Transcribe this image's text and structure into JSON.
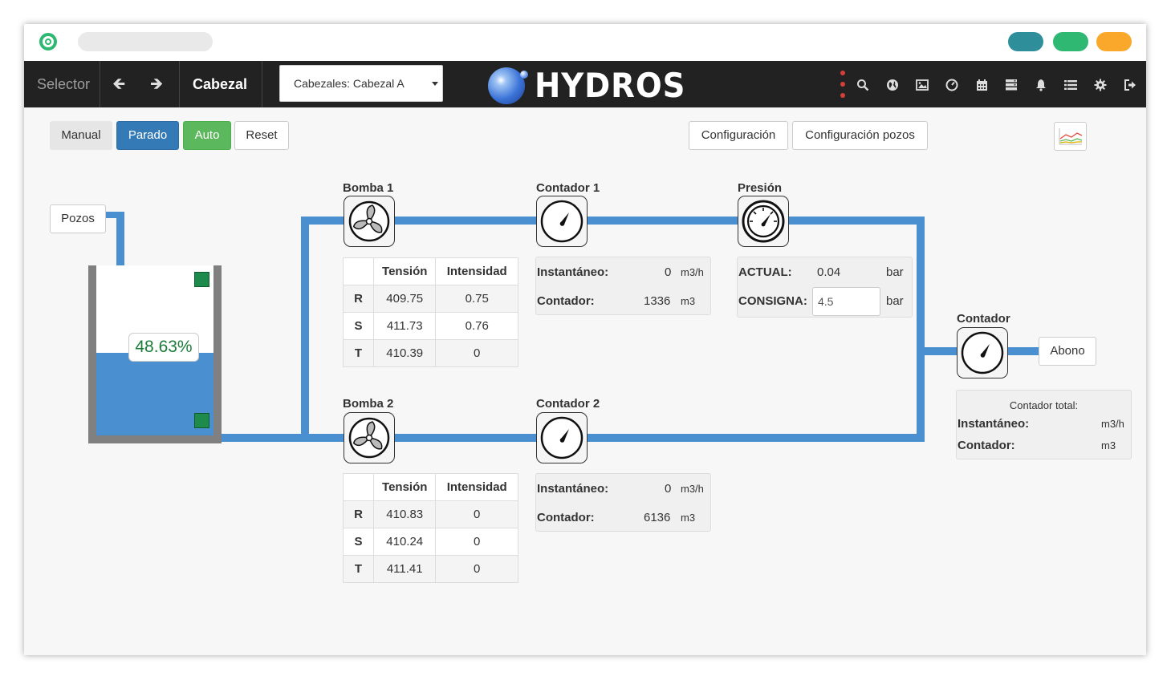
{
  "colors": {
    "pipe": "#4a8fd0",
    "tank_fill": "#4a8fd0",
    "sensor": "#1e8a4c",
    "level_text": "#1c7c3a",
    "navbar": "#222222",
    "btn_primary": "#337ab7",
    "btn_success": "#5cb85c"
  },
  "chrome": {
    "pill_colors": [
      "#2e8f9b",
      "#2eb872",
      "#f9a82b"
    ]
  },
  "navbar": {
    "selector_label": "Selector",
    "back_icon": "arrow-left-icon",
    "forward_icon": "arrow-right-icon",
    "section_label": "Cabezal",
    "select_value": "Cabezales: Cabezal A",
    "brand": "HYDROS",
    "icons": [
      "search-icon",
      "globe-icon",
      "image-icon",
      "dashboard-icon",
      "calendar-icon",
      "server-icon",
      "bell-icon",
      "list-icon",
      "gear-icon",
      "logout-icon"
    ]
  },
  "toolbar": {
    "manual": "Manual",
    "parado": "Parado",
    "auto": "Auto",
    "reset": "Reset",
    "configuracion": "Configuración",
    "configuracion_pozos": "Configuración pozos",
    "chart_icon": "line-chart-icon"
  },
  "pozos_label": "Pozos",
  "tank": {
    "level_percent": 48.63,
    "level_label": "48.63%"
  },
  "bomba1": {
    "title": "Bomba 1",
    "headers": [
      "Tensión",
      "Intensidad"
    ],
    "rows": [
      {
        "phase": "R",
        "tension": "409.75",
        "intensidad": "0.75"
      },
      {
        "phase": "S",
        "tension": "411.73",
        "intensidad": "0.76"
      },
      {
        "phase": "T",
        "tension": "410.39",
        "intensidad": "0"
      }
    ]
  },
  "bomba2": {
    "title": "Bomba 2",
    "headers": [
      "Tensión",
      "Intensidad"
    ],
    "rows": [
      {
        "phase": "R",
        "tension": "410.83",
        "intensidad": "0"
      },
      {
        "phase": "S",
        "tension": "410.24",
        "intensidad": "0"
      },
      {
        "phase": "T",
        "tension": "411.41",
        "intensidad": "0"
      }
    ]
  },
  "contador1": {
    "title": "Contador 1",
    "inst_label": "Instantáneo:",
    "inst_value": "0",
    "inst_unit": "m3/h",
    "cont_label": "Contador:",
    "cont_value": "1336",
    "cont_unit": "m3"
  },
  "contador2": {
    "title": "Contador 2",
    "inst_label": "Instantáneo:",
    "inst_value": "0",
    "inst_unit": "m3/h",
    "cont_label": "Contador:",
    "cont_value": "6136",
    "cont_unit": "m3"
  },
  "presion": {
    "title": "Presión",
    "actual_label": "ACTUAL:",
    "actual_value": "0.04",
    "actual_unit": "bar",
    "consigna_label": "CONSIGNA:",
    "consigna_value": "4.5",
    "consigna_unit": "bar"
  },
  "contador_total": {
    "title": "Contador",
    "caption": "Contador total:",
    "inst_label": "Instantáneo:",
    "inst_unit": "m3/h",
    "cont_label": "Contador:",
    "cont_unit": "m3"
  },
  "abono_label": "Abono"
}
